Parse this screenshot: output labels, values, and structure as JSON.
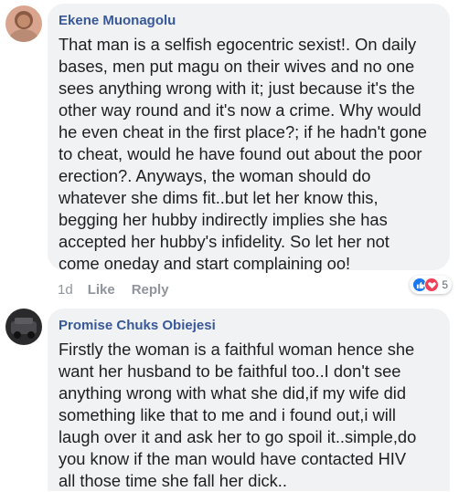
{
  "comments": [
    {
      "author": "Ekene Muonagolu",
      "text": "That man is a selfish egocentric sexist!. On daily\nbases, men put magu on their wives and no one\nsees anything wrong with it; just because it's the\nother way round and it's now a crime. Why would\nhe even cheat in the first place?; if he hadn't gone\nto cheat, would he have found out about the poor\nerection?. Anyways, the woman should do\nwhatever she dims fit..but let her know this,\nbegging her hubby indirectly implies she has\naccepted her hubby's infidelity. So let her not\ncome oneday and start complaining oo!",
      "time": "1d",
      "like_label": "Like",
      "reply_label": "Reply",
      "reaction_count": "5",
      "reaction_icons": [
        "like-icon",
        "love-icon"
      ]
    },
    {
      "author": "Promise Chuks Obiejesi",
      "text": "Firstly the woman is a faithful woman hence she\nwant her husband to be faithful too..I don't see\nanything wrong with what she did,if my wife did\nsomething like that to me and i found out,i will\nlaugh over it and ask her to go spoil it..simple,do\nyou know if the man would have contacted HIV\nall those time she fall her dick.."
    }
  ],
  "colors": {
    "author": "#385898",
    "bubble": "#f1f2f4",
    "meta": "#90949c",
    "like_blue": "#1877f2",
    "love_red": "#f33e58"
  }
}
